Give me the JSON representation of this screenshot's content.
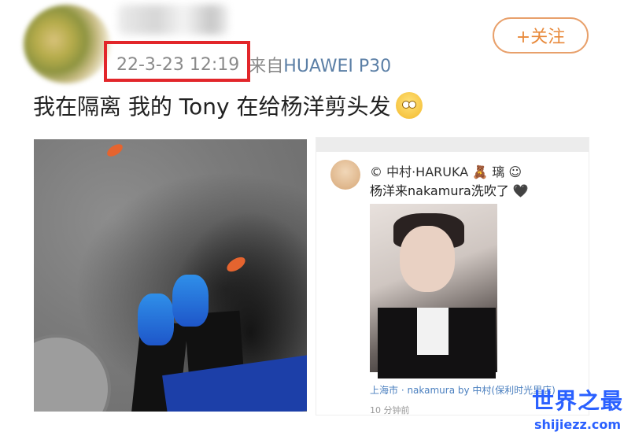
{
  "post": {
    "timestamp": "22-3-23 12:19",
    "source_prefix": "来自",
    "source_device": "HUAWEI P30",
    "follow_label": "+关注",
    "text": "我在隔离 我的 Tony 在给杨洋剪头发",
    "emoji": "eye-roll-emoji"
  },
  "embedded_screenshot": {
    "user_name": "© 中村·HARUKA 🧸 璃 ☺",
    "caption": "杨洋来nakamura洗吹了 🖤",
    "location_tag": "上海市 · nakamura by 中村(保利时光里店)",
    "stats": "10 分钟前"
  },
  "watermark": {
    "main": "世界之最",
    "sub": "shijiezz.com"
  },
  "colors": {
    "follow": "#e88a3c",
    "highlight_box": "#e2262a",
    "link_blue": "#5b7fa6",
    "watermark": "#2a60ff"
  }
}
